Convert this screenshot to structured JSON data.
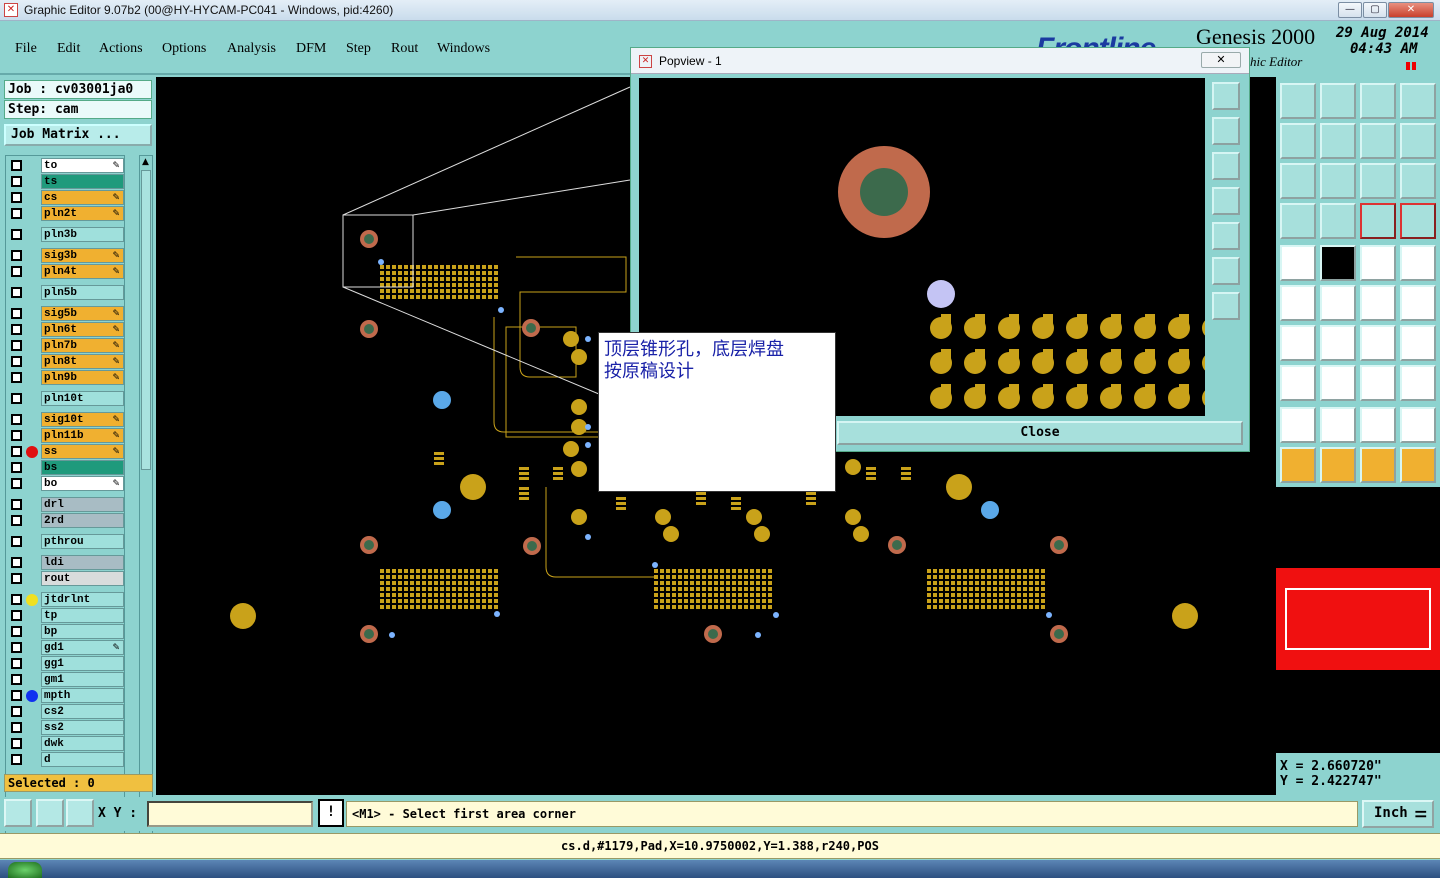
{
  "window": {
    "title": "Graphic Editor 9.07b2 (00@HY-HYCAM-PC041 - Windows, pid:4260)"
  },
  "menu": [
    "File",
    "Edit",
    "Actions",
    "Options",
    "Analysis",
    "DFM",
    "Step",
    "Rout",
    "Windows"
  ],
  "header": {
    "product": "Genesis 2000",
    "subtitle": "hic Editor",
    "date": "29 Aug 2014",
    "time": "04:43 AM"
  },
  "job": {
    "job_label": "Job : cv03001ja0",
    "step_label": "Step: cam",
    "matrix_button": "Job Matrix ..."
  },
  "layers": [
    {
      "name": "to",
      "color": "#ffffff",
      "marker": "",
      "writable": true
    },
    {
      "name": "ts",
      "color": "#1f9a7c",
      "marker": "",
      "writable": false
    },
    {
      "name": "cs",
      "color": "#f0b030",
      "marker": "",
      "writable": true
    },
    {
      "name": "pln2t",
      "color": "#f0b030",
      "marker": "",
      "writable": true
    },
    {
      "name": "pln3b",
      "color": "#9fe0dc",
      "marker": "",
      "writable": false
    },
    {
      "name": "sig3b",
      "color": "#f0b030",
      "marker": "",
      "writable": true
    },
    {
      "name": "pln4t",
      "color": "#f0b030",
      "marker": "",
      "writable": true
    },
    {
      "name": "pln5b",
      "color": "#9fe0dc",
      "marker": "",
      "writable": false
    },
    {
      "name": "sig5b",
      "color": "#f0b030",
      "marker": "",
      "writable": true
    },
    {
      "name": "pln6t",
      "color": "#f0b030",
      "marker": "",
      "writable": true
    },
    {
      "name": "pln7b",
      "color": "#f0b030",
      "marker": "",
      "writable": true
    },
    {
      "name": "pln8t",
      "color": "#f0b030",
      "marker": "",
      "writable": true
    },
    {
      "name": "pln9b",
      "color": "#f0b030",
      "marker": "",
      "writable": true
    },
    {
      "name": "pln10t",
      "color": "#9fe0dc",
      "marker": "",
      "writable": false
    },
    {
      "name": "sig10t",
      "color": "#f0b030",
      "marker": "",
      "writable": true
    },
    {
      "name": "pln11b",
      "color": "#f0b030",
      "marker": "",
      "writable": true
    },
    {
      "name": "ss",
      "color": "#f0b030",
      "marker": "#e01010",
      "writable": true
    },
    {
      "name": "bs",
      "color": "#1f9a7c",
      "marker": "",
      "writable": false
    },
    {
      "name": "bo",
      "color": "#ffffff",
      "marker": "",
      "writable": true
    },
    {
      "name": "drl",
      "color": "#a8bcc4",
      "marker": "",
      "writable": false
    },
    {
      "name": "2rd",
      "color": "#a8bcc4",
      "marker": "",
      "writable": false
    },
    {
      "name": "pthrou",
      "color": "#9fe0dc",
      "marker": "",
      "writable": false
    },
    {
      "name": "ldi",
      "color": "#a8bcc4",
      "marker": "",
      "writable": false
    },
    {
      "name": "rout",
      "color": "#d8dcdc",
      "marker": "",
      "writable": false
    },
    {
      "name": "jtdrlnt",
      "color": "#9fe0dc",
      "marker": "#f0e020",
      "writable": false
    },
    {
      "name": "tp",
      "color": "#9fe0dc",
      "marker": "",
      "writable": false
    },
    {
      "name": "bp",
      "color": "#9fe0dc",
      "marker": "",
      "writable": false
    },
    {
      "name": "gd1",
      "color": "#9fe0dc",
      "marker": "",
      "writable": true
    },
    {
      "name": "gg1",
      "color": "#9fe0dc",
      "marker": "",
      "writable": false
    },
    {
      "name": "gm1",
      "color": "#9fe0dc",
      "marker": "",
      "writable": false
    },
    {
      "name": "mpth",
      "color": "#9fe0dc",
      "marker": "#1030f0",
      "writable": false
    },
    {
      "name": "cs2",
      "color": "#9fe0dc",
      "marker": "",
      "writable": false
    },
    {
      "name": "ss2",
      "color": "#9fe0dc",
      "marker": "",
      "writable": false
    },
    {
      "name": "dwk",
      "color": "#9fe0dc",
      "marker": "",
      "writable": false
    },
    {
      "name": "d",
      "color": "#9fe0dc",
      "marker": "",
      "writable": false
    }
  ],
  "selected": "Selected : 0",
  "popview": {
    "title": "Popview - 1",
    "close_label": "Close"
  },
  "annotation": {
    "line1": "顶层锥形孔，底层焊盘",
    "line2": "按原稿设计"
  },
  "coords": {
    "x": "X = 2.660720\"",
    "y": "Y = 2.422747\""
  },
  "bottom": {
    "xy_label": "X Y :",
    "xy_value": "",
    "message": "<M1> - Select first area corner",
    "unit": "Inch"
  },
  "status": "cs.d,#1179,Pad,X=10.9750002,Y=1.388,r240,POS",
  "colors": {
    "panel": "#8dd3cf",
    "pad": "#c9a21a",
    "ring": "#c06a4c",
    "via": "#5aa8e8",
    "highlight": "#f0b030"
  }
}
